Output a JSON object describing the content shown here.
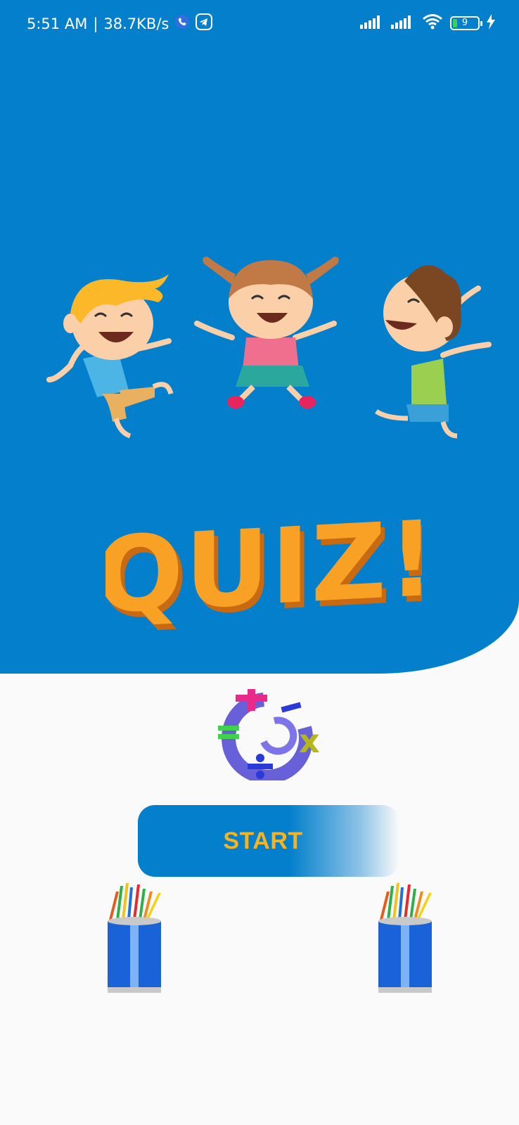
{
  "status_bar": {
    "time": "5:51 AM",
    "separator": "|",
    "speed": "38.7KB/s",
    "battery_level": "9",
    "icons": [
      "phone-call-icon",
      "telegram-icon",
      "signal-icon",
      "signal-icon",
      "wifi-icon",
      "battery-icon",
      "charging-icon"
    ]
  },
  "hero": {
    "title": "QUIZ!",
    "illustration": "three-jumping-kids"
  },
  "logo": {
    "icon": "math-operators-logo"
  },
  "start_button": {
    "label": "START"
  },
  "decorations": [
    "pencil-cup-icon",
    "pencil-cup-icon"
  ],
  "colors": {
    "hero_background": "#037fcc",
    "page_background": "#fafafa",
    "title_orange": "#f9a124",
    "button_text": "#f6b321"
  }
}
